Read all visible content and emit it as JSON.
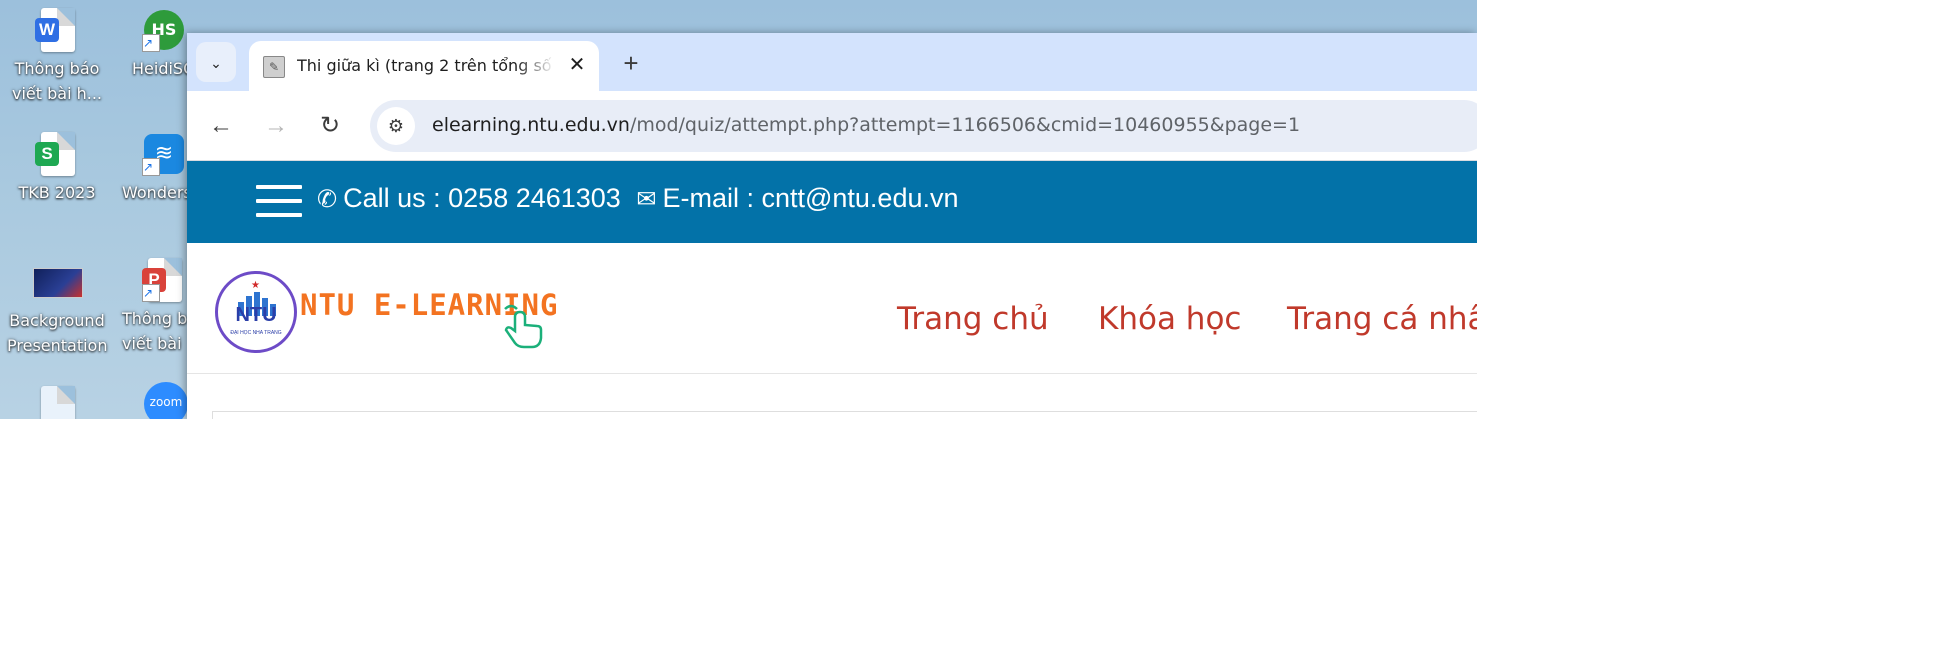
{
  "desktop": {
    "icons": [
      {
        "label": "Thông báo viết bài h...",
        "badge": "W",
        "color": "#2f6fe4"
      },
      {
        "label": "HeidiSQ",
        "badge": "HS",
        "color": "#2e9b3b"
      },
      {
        "label": "TKB 2023",
        "badge": "S",
        "color": "#1ea852"
      },
      {
        "label": "Wonders",
        "badge": "wifi",
        "color": "#1b88e0"
      },
      {
        "label": "Background Presentation",
        "badge": "",
        "color": "#1a2a6c"
      },
      {
        "label": "Thông b viết bài",
        "badge": "P",
        "color": "#d9423a"
      },
      {
        "label": "",
        "badge": "",
        "color": "#2f6fe4"
      },
      {
        "label": "",
        "badge": "zoom",
        "color": "#2d8cff"
      }
    ]
  },
  "browser": {
    "tab_title": "Thi giữa kì (trang 2 trên tổng số",
    "address": {
      "domain": "elearning.ntu.edu.vn",
      "path": "/mod/quiz/attempt.php?attempt=1166506&cmid=10460955&page=1"
    }
  },
  "site": {
    "call_us": "Call us : 0258 2461303",
    "email": "E-mail : cntt@ntu.edu.vn",
    "brand": "NTU E-LEARNING",
    "logo_text": "NTU",
    "logo_sub": "ĐẠI HỌC NHA TRANG",
    "menu": [
      "Trang chủ",
      "Khóa học",
      "Trang cá nhâ"
    ]
  },
  "colors": {
    "topbar": "#0372a8",
    "menu_text": "#c0392b",
    "brand_orange": "#f37321"
  }
}
